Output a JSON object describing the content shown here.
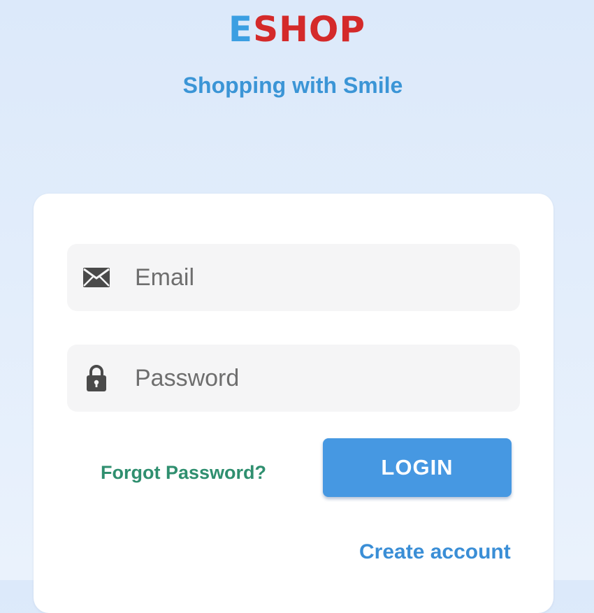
{
  "header": {
    "logo_first": "E",
    "logo_rest": "SHOP",
    "tagline": "Shopping with Smile"
  },
  "form": {
    "email": {
      "placeholder": "Email",
      "value": "",
      "icon": "envelope-icon"
    },
    "password": {
      "placeholder": "Password",
      "value": "",
      "icon": "lock-icon"
    },
    "forgot_label": "Forgot Password?",
    "login_label": "LOGIN",
    "create_label": "Create account"
  },
  "colors": {
    "logo_blue": "#3b9fe2",
    "logo_red": "#d42a2a",
    "tagline": "#3b95d6",
    "primary_button": "#4698e2",
    "forgot_link": "#2f8f6f",
    "create_link": "#3a8ed6"
  }
}
